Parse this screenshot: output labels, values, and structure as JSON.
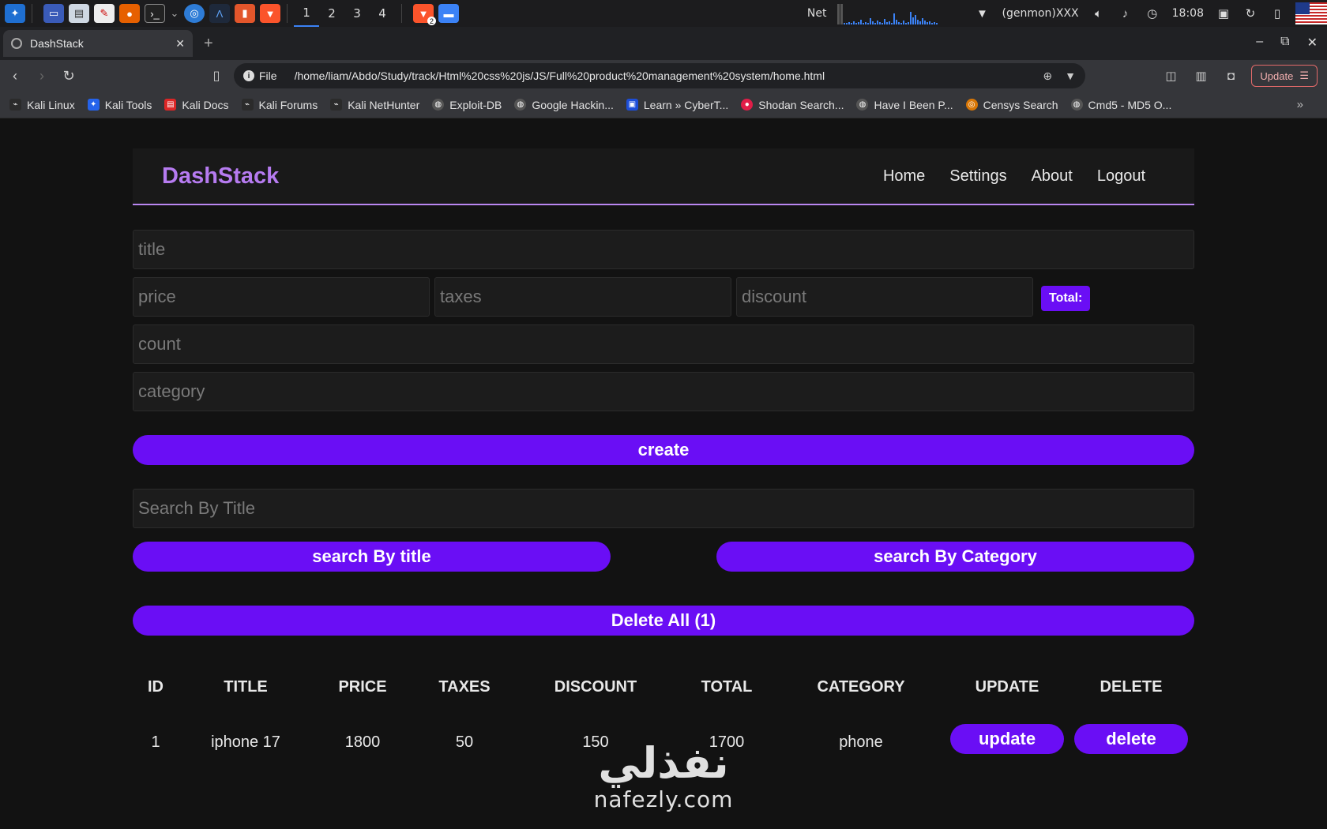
{
  "taskbar": {
    "workspaces": [
      "1",
      "2",
      "3",
      "4"
    ],
    "net_label": "Net",
    "genmon": "(genmon)XXX",
    "clock": "18:08",
    "browser_badge": "2"
  },
  "browser": {
    "tab_title": "DashStack",
    "url_scheme": "File",
    "url": "/home/liam/Abdo/Study/track/Html%20css%20js/JS/Full%20product%20management%20system/home.html",
    "update_label": "Update",
    "bookmarks": [
      {
        "label": "Kali Linux",
        "color": "#2b2b2b"
      },
      {
        "label": "Kali Tools",
        "color": "#2563eb"
      },
      {
        "label": "Kali Docs",
        "color": "#dc2626"
      },
      {
        "label": "Kali Forums",
        "color": "#2b2b2b"
      },
      {
        "label": "Kali NetHunter",
        "color": "#2b2b2b"
      },
      {
        "label": "Exploit-DB",
        "color": "#555"
      },
      {
        "label": "Google Hackin...",
        "color": "#555"
      },
      {
        "label": "Learn » CyberT...",
        "color": "#1d4ed8"
      },
      {
        "label": "Shodan Search...",
        "color": "#e11d48"
      },
      {
        "label": "Have I Been P...",
        "color": "#555"
      },
      {
        "label": "Censys Search",
        "color": "#d97706"
      },
      {
        "label": "Cmd5 - MD5 O...",
        "color": "#555"
      }
    ]
  },
  "app": {
    "brand": "DashStack",
    "nav": [
      "Home",
      "Settings",
      "About",
      "Logout"
    ],
    "form": {
      "title_placeholder": "title",
      "price_placeholder": "price",
      "taxes_placeholder": "taxes",
      "discount_placeholder": "discount",
      "total_label": "Total:",
      "count_placeholder": "count",
      "category_placeholder": "category",
      "create_label": "create"
    },
    "search": {
      "placeholder": "Search By Title",
      "by_title_label": "search By title",
      "by_category_label": "search By Category"
    },
    "delete_all_label": "Delete All (1)",
    "table": {
      "headers": [
        "ID",
        "TITLE",
        "PRICE",
        "TAXES",
        "DISCOUNT",
        "TOTAL",
        "CATEGORY",
        "UPDATE",
        "DELETE"
      ],
      "rows": [
        {
          "id": "1",
          "title": "iphone 17",
          "price": "1800",
          "taxes": "50",
          "discount": "150",
          "total": "1700",
          "category": "phone",
          "update": "update",
          "delete": "delete"
        }
      ]
    },
    "accent_color": "#6a0ef5",
    "brand_color": "#b67bf0"
  },
  "watermark": {
    "arabic": "نفذلي",
    "latin": "nafezly.com"
  }
}
